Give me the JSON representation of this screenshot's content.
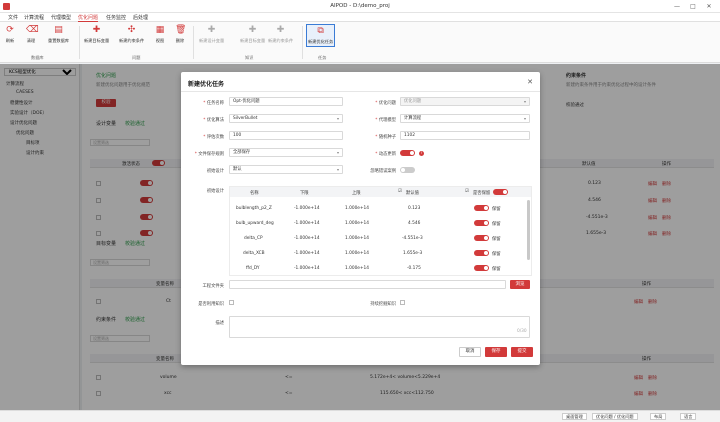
{
  "titlebar": {
    "title": "AIPOD - D:\\demo_proj",
    "minimize": "—",
    "maximize": "□",
    "close": "✕"
  },
  "menu": [
    "文件",
    "计算流程",
    "代理模型",
    "优化问题",
    "任务监控",
    "后处理"
  ],
  "ribbon": {
    "buttons": [
      "刷新",
      "清理",
      "重置数据库",
      "新建目标变量",
      "新建约束条件",
      "视图",
      "删除",
      "新建设计变量",
      "新建目标变量",
      "新建约束条件",
      "新建优化任务"
    ],
    "groups": [
      "数据库",
      "问题",
      "知识",
      "任务"
    ]
  },
  "tree": {
    "select": "KCS船型优化",
    "items": [
      "计算流程",
      "CAESES",
      "稳健性设计",
      "实验设计（DOE）",
      "设计优化问题",
      "优化问题",
      "目标项",
      "设计约束"
    ]
  },
  "main": {
    "opt_title": "优化问题",
    "opt_title_status": "校验通过",
    "opt_sub": "新建优化问题用于优化规范",
    "opt_btn": "校验",
    "dv_title": "设计变量",
    "dv_status": "校验通过",
    "dv_filter": "设置筛选",
    "dv_headers": [
      "激活状态",
      "默认值",
      "操作"
    ],
    "dv_defaults": [
      "0.123",
      "4.546",
      "-4.551e-3",
      "1.655e-3"
    ],
    "obj_title": "目标变量",
    "obj_status": "校验通过",
    "obj_headers": [
      "变量名称",
      "操作"
    ],
    "obj_row_name": "Ct",
    "con_title": "约束条件",
    "con_status": "校验通过",
    "con_headers": [
      "变量名称",
      "操作"
    ],
    "con_rows": [
      {
        "name": "volume",
        "op": "<=",
        "val": "5.172e+4< volume<5.229e+4"
      },
      {
        "name": "xcc",
        "op": "<=",
        "val": "115.650< xcc<112.750"
      }
    ],
    "edit": "编辑",
    "del": "删除",
    "right_title": "约束条件",
    "right_sub": "新建约束条件用于约束优化过程中的设计条件",
    "right_status": "校验通过"
  },
  "statusbar": [
    "桌面管理",
    "优化问题 / 优化问题",
    "布局",
    "语言"
  ],
  "modal": {
    "title": "新建优化任务",
    "close": "✕",
    "fields": {
      "task_name_label": "任务名称",
      "task_name": "Opt-优化问题",
      "problem_label": "优化问题",
      "problem": "优化问题",
      "algo_label": "优化算法",
      "algo": "SilverBullet",
      "surrogate_label": "代理模型",
      "surrogate": "计算流程",
      "evals_label": "评估次数",
      "evals": "100",
      "seed_label": "随机种子",
      "seed": "1102",
      "save_label": "文件保存规则",
      "save": "全部保存",
      "dynamic_label": "动态更新",
      "init_label": "初始设计",
      "init": "默认",
      "ignore_label": "忽略错误案例",
      "init_design_label": "初始设计",
      "workdir_label": "工程文件夹",
      "browse": "浏览",
      "knowledge_label": "是否利用知识",
      "persist_label": "持续挖掘知识",
      "desc_label": "描述",
      "desc_counter": "0/30"
    },
    "table": {
      "headers": [
        "名称",
        "下限",
        "上限",
        "默认值",
        "是否保留"
      ],
      "rows": [
        {
          "name": "bulblength_p2_Z",
          "lo": "-1.000e+14",
          "hi": "1.000e+14",
          "def": "0.123",
          "keep": "保留"
        },
        {
          "name": "bulb_upward_deg",
          "lo": "-1.000e+14",
          "hi": "1.000e+14",
          "def": "4.546",
          "keep": "保留"
        },
        {
          "name": "delta_CP",
          "lo": "-1.000e+14",
          "hi": "1.000e+14",
          "def": "-4.551e-3",
          "keep": "保留"
        },
        {
          "name": "delta_XCB",
          "lo": "-1.000e+14",
          "hi": "1.000e+14",
          "def": "1.655e-3",
          "keep": "保留"
        },
        {
          "name": "ffd_DY",
          "lo": "-1.000e+14",
          "hi": "1.000e+14",
          "def": "-0.175",
          "keep": "保留"
        }
      ]
    },
    "buttons": {
      "cancel": "取消",
      "save": "保存",
      "submit": "提交"
    }
  },
  "colors": {
    "accent": "#d23a3a",
    "ok": "#2a9d48",
    "select": "#3a7bd5"
  }
}
